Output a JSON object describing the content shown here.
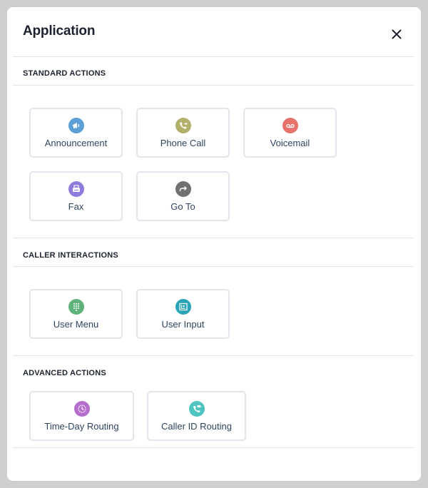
{
  "dialog": {
    "title": "Application",
    "close_icon": "close-icon"
  },
  "sections": [
    {
      "title": "STANDARD ACTIONS",
      "items": [
        {
          "label": "Announcement",
          "icon": "megaphone-icon",
          "color": "#5b9fd6"
        },
        {
          "label": "Phone Call",
          "icon": "phone-forward-icon",
          "color": "#b3b06b"
        },
        {
          "label": "Voicemail",
          "icon": "voicemail-icon",
          "color": "#e8736d"
        },
        {
          "label": "Fax",
          "icon": "fax-icon",
          "color": "#8f7bdc"
        },
        {
          "label": "Go To",
          "icon": "goto-arrow-icon",
          "color": "#707070"
        }
      ]
    },
    {
      "title": "CALLER INTERACTIONS",
      "items": [
        {
          "label": "User Menu",
          "icon": "keypad-icon",
          "color": "#5fb27a"
        },
        {
          "label": "User Input",
          "icon": "input-keyboard-icon",
          "color": "#2aa5b8"
        }
      ]
    },
    {
      "title": "ADVANCED ACTIONS",
      "items": [
        {
          "label": "Time-Day Routing",
          "icon": "clock-icon",
          "color": "#b46fcc"
        },
        {
          "label": "Caller ID Routing",
          "icon": "caller-id-icon",
          "color": "#4fc4c0"
        }
      ]
    }
  ]
}
